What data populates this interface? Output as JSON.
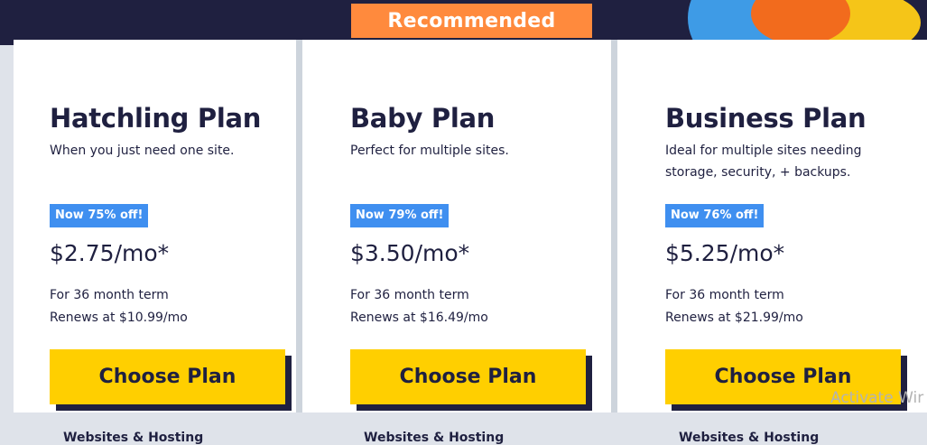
{
  "recommended_label": "Recommended",
  "plans": [
    {
      "title": "Hatchling Plan",
      "description": "When you just need one site.",
      "discount": "Now 75% off!",
      "price": "$2.75/mo*",
      "term": "For 36 month term",
      "renewal": "Renews at $10.99/mo",
      "button_label": "Choose Plan",
      "features_heading": "Websites & Hosting"
    },
    {
      "title": "Baby Plan",
      "description": "Perfect for multiple sites.",
      "discount": "Now 79% off!",
      "price": "$3.50/mo*",
      "term": "For 36 month term",
      "renewal": "Renews at $16.49/mo",
      "button_label": "Choose Plan",
      "features_heading": "Websites & Hosting"
    },
    {
      "title": "Business Plan",
      "description": "Ideal for multiple sites needing storage, security, + backups.",
      "discount": "Now 76% off!",
      "price": "$5.25/mo*",
      "term": "For 36 month term",
      "renewal": "Renews at $21.99/mo",
      "button_label": "Choose Plan",
      "features_heading": "Websites & Hosting"
    }
  ],
  "watermark_text": "Activate Wir",
  "colors": {
    "navy": "#1f2040",
    "ribbon_orange": "#ff8a3d",
    "badge_blue": "#3f8ff0",
    "button_yellow": "#ffcf00"
  }
}
